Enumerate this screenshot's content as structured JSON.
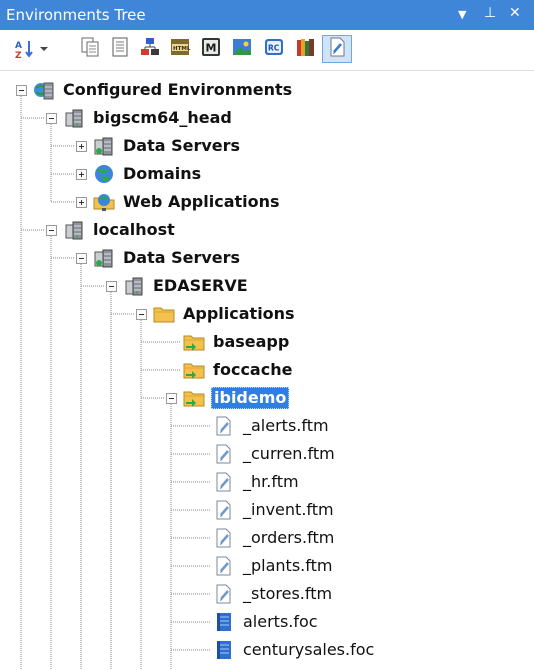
{
  "panel": {
    "title": "Environments Tree",
    "controls": {
      "dropdown_glyph": "▼",
      "pin_glyph": "⊥",
      "close_glyph": "✕"
    }
  },
  "toolbar": {
    "buttons": [
      {
        "name": "sort-icon",
        "active": false
      },
      {
        "name": "copy-icon",
        "active": false
      },
      {
        "name": "document-icon",
        "active": false
      },
      {
        "name": "hierarchy-icon",
        "active": false
      },
      {
        "name": "html-icon",
        "active": false
      },
      {
        "name": "master-file-icon",
        "active": false
      },
      {
        "name": "image-icon",
        "active": false
      },
      {
        "name": "rc-icon",
        "active": false
      },
      {
        "name": "books-icon",
        "active": false
      },
      {
        "name": "procedure-icon",
        "active": true
      }
    ]
  },
  "tree": {
    "selected_node": "ibidemo",
    "nodes": [
      {
        "label": "Configured Environments",
        "bold": true,
        "icon": "globe-server-icon",
        "level": 0,
        "toggle": "minus"
      },
      {
        "label": "bigscm64_head",
        "bold": true,
        "icon": "server-icon",
        "level": 1,
        "toggle": "minus"
      },
      {
        "label": "Data Servers",
        "bold": true,
        "icon": "data-servers-icon",
        "level": 2,
        "toggle": "plus"
      },
      {
        "label": "Domains",
        "bold": true,
        "icon": "domains-globe-icon",
        "level": 2,
        "toggle": "plus"
      },
      {
        "label": "Web Applications",
        "bold": true,
        "icon": "web-apps-icon",
        "level": 2,
        "toggle": "plus"
      },
      {
        "label": "localhost",
        "bold": true,
        "icon": "server-icon",
        "level": 1,
        "toggle": "minus"
      },
      {
        "label": "Data Servers",
        "bold": true,
        "icon": "data-servers-icon",
        "level": 2,
        "toggle": "minus"
      },
      {
        "label": "EDASERVE",
        "bold": true,
        "icon": "server-icon",
        "level": 3,
        "toggle": "minus"
      },
      {
        "label": "Applications",
        "bold": true,
        "icon": "folder-icon",
        "level": 4,
        "toggle": "minus"
      },
      {
        "label": "baseapp",
        "bold": true,
        "icon": "app-folder-icon",
        "level": 5,
        "toggle": null
      },
      {
        "label": "foccache",
        "bold": true,
        "icon": "app-folder-icon",
        "level": 5,
        "toggle": null
      },
      {
        "label": "ibidemo",
        "bold": true,
        "icon": "app-folder-icon",
        "level": 5,
        "toggle": "minus",
        "selected": true
      },
      {
        "label": "_alerts.ftm",
        "bold": false,
        "icon": "procedure-file-icon",
        "level": 6,
        "toggle": null
      },
      {
        "label": "_curren.ftm",
        "bold": false,
        "icon": "procedure-file-icon",
        "level": 6,
        "toggle": null
      },
      {
        "label": "_hr.ftm",
        "bold": false,
        "icon": "procedure-file-icon",
        "level": 6,
        "toggle": null
      },
      {
        "label": "_invent.ftm",
        "bold": false,
        "icon": "procedure-file-icon",
        "level": 6,
        "toggle": null
      },
      {
        "label": "_orders.ftm",
        "bold": false,
        "icon": "procedure-file-icon",
        "level": 6,
        "toggle": null
      },
      {
        "label": "_plants.ftm",
        "bold": false,
        "icon": "procedure-file-icon",
        "level": 6,
        "toggle": null
      },
      {
        "label": "_stores.ftm",
        "bold": false,
        "icon": "procedure-file-icon",
        "level": 6,
        "toggle": null
      },
      {
        "label": "alerts.foc",
        "bold": false,
        "icon": "focus-data-file-icon",
        "level": 6,
        "toggle": null
      },
      {
        "label": "centurysales.foc",
        "bold": false,
        "icon": "focus-data-file-icon",
        "level": 6,
        "toggle": null
      }
    ]
  },
  "colors": {
    "title_bar": "#3f86d8",
    "selection": "#2f7fe0",
    "tree_lines": "#8a8a8a",
    "folder": "#f2c14e",
    "server": "#7a7f86"
  }
}
